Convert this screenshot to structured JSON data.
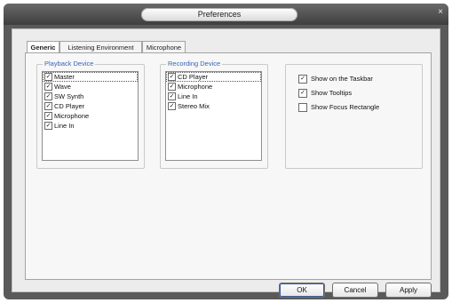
{
  "window": {
    "title": "Preferences",
    "close_glyph": "×"
  },
  "tabs": [
    {
      "label": "Generic"
    },
    {
      "label": "Listening Environment"
    },
    {
      "label": "Microphone"
    }
  ],
  "playback": {
    "legend": "Playback Device",
    "items": [
      {
        "label": "Master",
        "checked": true
      },
      {
        "label": "Wave",
        "checked": true
      },
      {
        "label": "SW Synth",
        "checked": true
      },
      {
        "label": "CD Player",
        "checked": true
      },
      {
        "label": "Microphone",
        "checked": true
      },
      {
        "label": "Line In",
        "checked": true
      }
    ]
  },
  "recording": {
    "legend": "Recording Device",
    "items": [
      {
        "label": "CD Player",
        "checked": true
      },
      {
        "label": "Microphone",
        "checked": true
      },
      {
        "label": "Line In",
        "checked": true
      },
      {
        "label": "Stereo Mix",
        "checked": true
      }
    ]
  },
  "options": [
    {
      "label": "Show on the Taskbar",
      "checked": true
    },
    {
      "label": "Show Tooltips",
      "checked": true
    },
    {
      "label": "Show Focus Rectangle",
      "checked": false
    }
  ],
  "buttons": {
    "ok": "OK",
    "cancel": "Cancel",
    "apply": "Apply"
  }
}
